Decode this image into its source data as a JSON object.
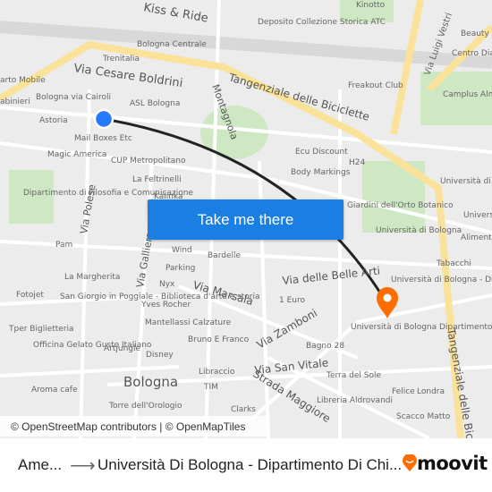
{
  "map": {
    "labels": [
      "Kiss & Ride",
      "Bologna Centrale",
      "Trenitalia",
      "Via Cesare Boldrini",
      "Tangenziale delle Biciclette",
      "arto Mobile",
      "Bologna via Cairoli",
      "abinieri",
      "ASL Bologna",
      "Astoria",
      "Mail Boxes Etc",
      "Magic America",
      "CUP Metropolitano",
      "La Feltrinelli",
      "Kalinka",
      "Dipartimento di Filosofia e Comunicazione",
      "Via Polese",
      "Pam",
      "Wind",
      "Bardelle",
      "Parking",
      "La Margherita",
      "Nyx",
      "Via Marsala",
      "Fotojet",
      "San Giorgio in Poggiale - Biblioteca d'arte e storia",
      "Yves Rocher",
      "Mantellassi Calzature",
      "Tper Biglietteria",
      "Officina Gelato Gusto Italiano",
      "Artjungle",
      "Bruno E Franco",
      "Disney",
      "Aroma cafe",
      "Bologna",
      "Libraccio",
      "TIM",
      "Torre dell'Orologio",
      "Clarks",
      "Montagnola",
      "Deposito Collezione Storica ATC",
      "Kinotto",
      "Via Luigi Vestri",
      "Beauty F",
      "Centro Diag Cavo",
      "Freakout Club",
      "Camplus Alma Mater",
      "Ecu Discount",
      "Body Markings",
      "H24",
      "Università di Bologna - Dipartimento di Fisica",
      "Giardini dell'Orto Botanico",
      "Università di Bologna",
      "Via delle Belle Arti",
      "Tabacchi",
      "Alimenta",
      "Università di Bologna - Dipartimento di Matematica",
      "Università di Bologna Dipartimento di Chimica \"G. Ciamician\"",
      "1 Euro",
      "Bagno 28",
      "Via Zamboni",
      "Via San Vitale",
      "Terra del Sole",
      "Strada Maggiore",
      "Libreria Aldrovandi",
      "Felice",
      "Londra",
      "Scacco Matto",
      "Tangenziale delle Bic",
      "Via Galliera",
      "Università di Bologna C"
    ],
    "origin_color": "#2979ff",
    "destination_color": "#ff6d00",
    "route_color": "#222222"
  },
  "cta": {
    "label": "Take me there"
  },
  "attribution": "© OpenStreetMap contributors | © OpenMapTiles",
  "footer": {
    "from": "Ame...",
    "to": "Università Di Bologna - Dipartimento Di Chi...",
    "logo": "moovit",
    "logo_color": "#ff6d00"
  }
}
